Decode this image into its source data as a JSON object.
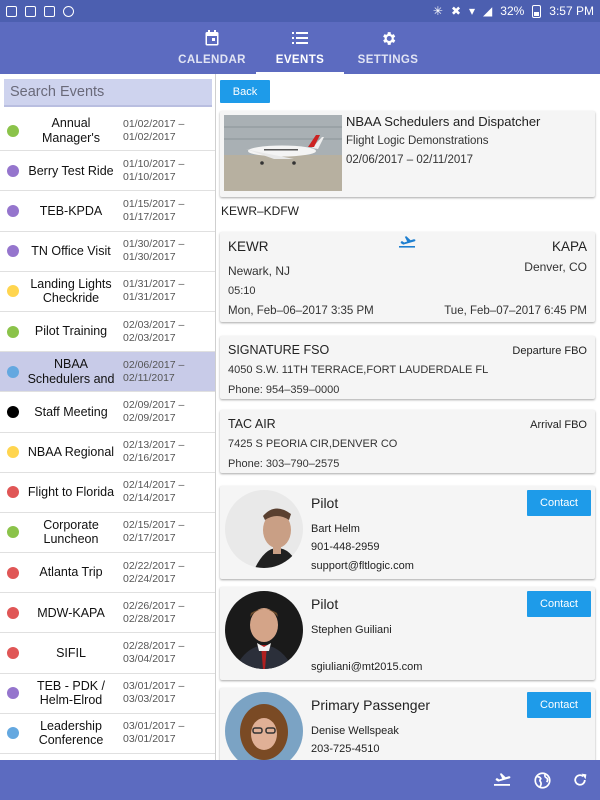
{
  "status_bar": {
    "battery": "32%",
    "time": "3:57 PM"
  },
  "nav": {
    "tabs": [
      {
        "label": "CALENDAR",
        "icon": "calendar-icon",
        "active": false
      },
      {
        "label": "EVENTS",
        "icon": "list-icon",
        "active": true
      },
      {
        "label": "SETTINGS",
        "icon": "gear-icon",
        "active": false
      }
    ]
  },
  "search": {
    "placeholder": "Search Events"
  },
  "events": [
    {
      "name": "Annual Manager's",
      "dates": "01/02/2017 –\n01/02/2017",
      "color": "#8bc34a"
    },
    {
      "name": "Berry Test Ride",
      "dates": "01/10/2017 –\n01/10/2017",
      "color": "#9575cd"
    },
    {
      "name": "TEB-KPDA",
      "dates": "01/15/2017 –\n01/17/2017",
      "color": "#9575cd"
    },
    {
      "name": "TN Office Visit",
      "dates": "01/30/2017 –\n01/30/2017",
      "color": "#9575cd"
    },
    {
      "name": "Landing Lights Checkride",
      "dates": "01/31/2017 –\n01/31/2017",
      "color": "#ffd54f"
    },
    {
      "name": "Pilot Training",
      "dates": "02/03/2017 –\n02/03/2017",
      "color": "#8bc34a"
    },
    {
      "name": "NBAA Schedulers and",
      "dates": "02/06/2017 –\n02/11/2017",
      "color": "#64a8e0"
    },
    {
      "name": "Staff Meeting",
      "dates": "02/09/2017 –\n02/09/2017",
      "color": "#000000"
    },
    {
      "name": "NBAA Regional",
      "dates": "02/13/2017 –\n02/16/2017",
      "color": "#ffd54f"
    },
    {
      "name": "Flight to Florida",
      "dates": "02/14/2017 –\n02/14/2017",
      "color": "#e05656"
    },
    {
      "name": "Corporate Luncheon",
      "dates": "02/15/2017 –\n02/17/2017",
      "color": "#8bc34a"
    },
    {
      "name": "Atlanta Trip",
      "dates": "02/22/2017 –\n02/24/2017",
      "color": "#e05656"
    },
    {
      "name": "MDW-KAPA",
      "dates": "02/26/2017 –\n02/28/2017",
      "color": "#e05656"
    },
    {
      "name": "SIFIL",
      "dates": "02/28/2017 –\n03/04/2017",
      "color": "#e05656"
    },
    {
      "name": "TEB - PDK / Helm-Elrod",
      "dates": "03/01/2017 –\n03/03/2017",
      "color": "#9575cd"
    },
    {
      "name": "Leadership Conference",
      "dates": "03/01/2017 –\n03/01/2017",
      "color": "#64a8e0"
    },
    {
      "name": "",
      "dates": "",
      "color": "#e05656"
    }
  ],
  "detail": {
    "back_label": "Back",
    "event": {
      "title": "NBAA Schedulers and Dispatcher",
      "subtitle": "Flight Logic Demonstrations",
      "dates": "02/06/2017 – 02/11/2017"
    },
    "route": "KEWR–KDFW",
    "flight": {
      "from_code": "KEWR",
      "from_city": "Newark, NJ",
      "duration": "05:10",
      "depart_time": "Mon, Feb–06–2017 3:35 PM",
      "to_code": "KAPA",
      "to_city": "Denver, CO",
      "arrive_time": "Tue, Feb–07–2017 6:45 PM"
    },
    "departure_fbo": {
      "name": "SIGNATURE FSO",
      "type": "Departure FBO",
      "address": "4050 S.W. 11TH TERRACE,FORT LAUDERDALE FL",
      "phone": "Phone: 954–359–0000"
    },
    "arrival_fbo": {
      "name": "TAC AIR",
      "type": "Arrival FBO",
      "address": "7425 S PEORIA CIR,DENVER CO",
      "phone": "Phone: 303–790–2575"
    },
    "crew": [
      {
        "role": "Pilot",
        "name": "Bart  Helm",
        "phone": "901-448-2959",
        "email": "support@fltlogic.com",
        "contact_label": "Contact"
      },
      {
        "role": "Pilot",
        "name": "Stephen Guiliani",
        "phone": "",
        "email": "sgiuliani@mt2015.com",
        "contact_label": "Contact"
      },
      {
        "role": "Primary Passenger",
        "name": "Denise Wellspeak",
        "phone": "203-725-4510",
        "email": "",
        "contact_label": "Contact"
      }
    ]
  },
  "bottom_bar": {
    "icons": [
      "flight-icon",
      "globe-icon",
      "refresh-icon"
    ]
  },
  "colors": {
    "primary": "#5c6bc0",
    "status_bar": "#4c5fb0",
    "accent_button": "#1e9be9",
    "selected_row": "#c8cbe8"
  }
}
